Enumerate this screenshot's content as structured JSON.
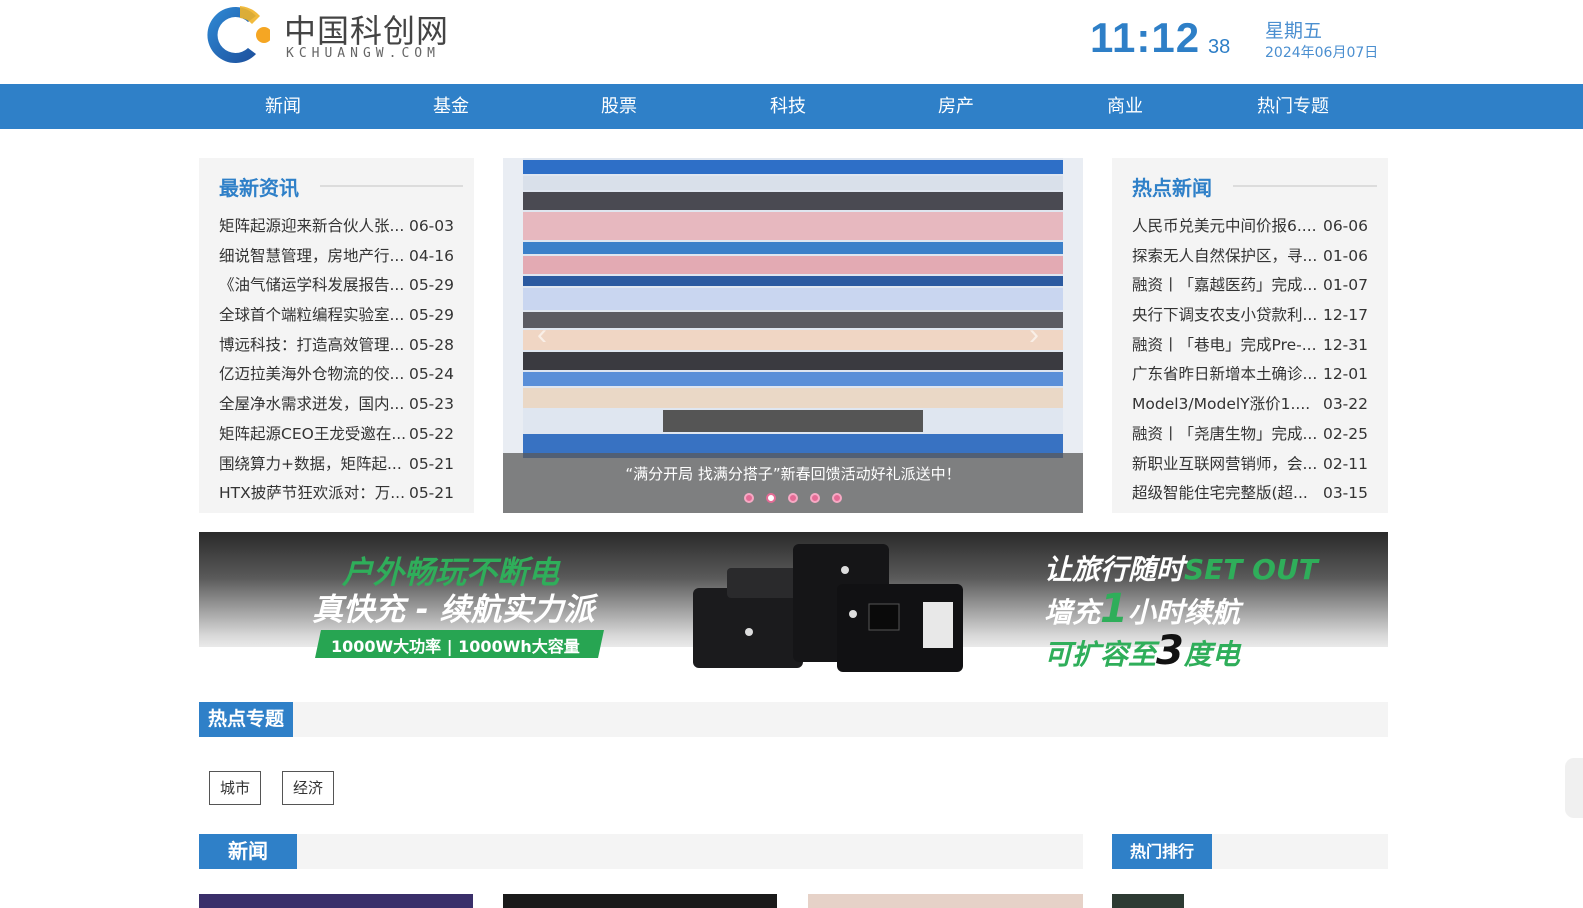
{
  "header": {
    "logo_cn": "中国科创网",
    "logo_en": "KCHUANGW.COM",
    "time": "11:12",
    "seconds": "38",
    "weekday": "星期五",
    "date": "2024年06月07日",
    "colors": {
      "brand_blue": "#2f80c8",
      "logo_orange": "#f5a623"
    }
  },
  "nav": {
    "items": [
      "新闻",
      "基金",
      "股票",
      "科技",
      "房产",
      "商业",
      "热门专题"
    ]
  },
  "latest": {
    "title": "最新资讯",
    "items": [
      {
        "title": "矩阵起源迎来新合伙人张...",
        "date": "06-03"
      },
      {
        "title": "细说智慧管理，房地产行...",
        "date": "04-16"
      },
      {
        "title": "《油气储运学科发展报告...",
        "date": "05-29"
      },
      {
        "title": "全球首个端粒编程实验室...",
        "date": "05-29"
      },
      {
        "title": "博远科技：打造高效管理...",
        "date": "05-28"
      },
      {
        "title": "亿迈拉美海外仓物流的佼...",
        "date": "05-24"
      },
      {
        "title": "全屋净水需求迸发，国内...",
        "date": "05-23"
      },
      {
        "title": "矩阵起源CEO王龙受邀在...",
        "date": "05-22"
      },
      {
        "title": "围绕算力+数据，矩阵起...",
        "date": "05-21"
      },
      {
        "title": "HTX披萨节狂欢派对：万...",
        "date": "05-21"
      }
    ]
  },
  "carousel": {
    "caption": "“满分开局 找满分搭子”新春回馈活动好礼派送中！",
    "slide_count": 5,
    "active_index": 1,
    "prev_icon": "chevron-left-icon",
    "next_icon": "chevron-right-icon"
  },
  "hot_news": {
    "title": "热点新闻",
    "items": [
      {
        "title": "人民币兑美元中间价报6....",
        "date": "06-06"
      },
      {
        "title": "探索无人自然保护区，寻...",
        "date": "01-06"
      },
      {
        "title": "融资丨「嘉越医药」完成...",
        "date": "01-07"
      },
      {
        "title": "央行下调支农支小贷款利...",
        "date": "12-17"
      },
      {
        "title": "融资丨「巷电」完成Pre-...",
        "date": "12-31"
      },
      {
        "title": "广东省昨日新增本土确诊...",
        "date": "12-01"
      },
      {
        "title": "Model3/ModelY涨价1....",
        "date": "03-22"
      },
      {
        "title": "融资丨「尧唐生物」完成...",
        "date": "02-25"
      },
      {
        "title": "新职业互联网营销师，会...",
        "date": "02-11"
      },
      {
        "title": "超级智能住宅完整版(超...",
        "date": "03-15"
      }
    ]
  },
  "banner": {
    "left_line1": "户外畅玩不断电",
    "left_line2": "真快充 - 续航实力派",
    "pill": "1000W大功率 | 1000Wh大容量",
    "right_line1_a": "让旅行随时",
    "right_line1_b": "SET OUT",
    "right_line2_a": "墙充",
    "right_line2_num": "1",
    "right_line2_b": "小时续航",
    "right_line3_a": "可扩容至",
    "right_line3_num": "3",
    "right_line3_b": "度电"
  },
  "hot_topics": {
    "title": "热点专题",
    "tags": [
      "城市",
      "经济"
    ]
  },
  "news_section": {
    "title": "新闻"
  },
  "ranking_section": {
    "title": "热门排行"
  }
}
